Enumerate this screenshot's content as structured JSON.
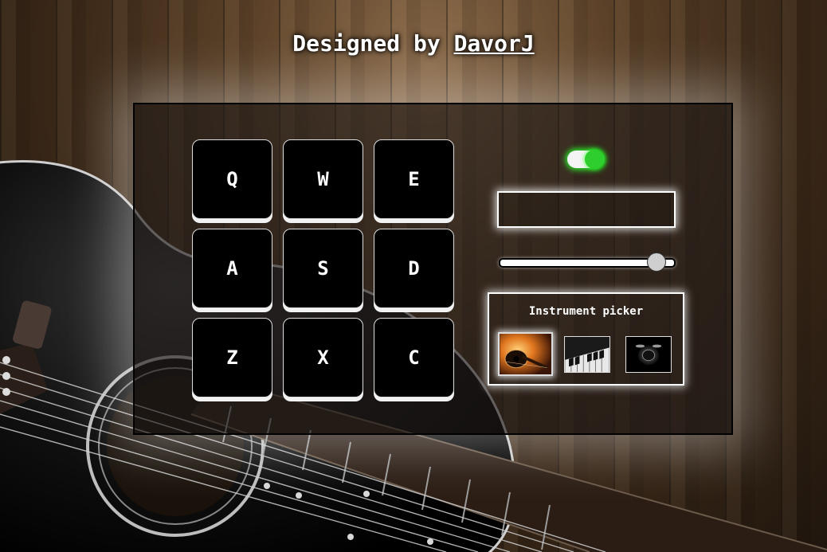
{
  "header": {
    "prefix": "Designed by",
    "author": "DavorJ"
  },
  "pads": [
    {
      "key": "Q"
    },
    {
      "key": "W"
    },
    {
      "key": "E"
    },
    {
      "key": "A"
    },
    {
      "key": "S"
    },
    {
      "key": "D"
    },
    {
      "key": "Z"
    },
    {
      "key": "X"
    },
    {
      "key": "C"
    }
  ],
  "controls": {
    "power": {
      "state": "on",
      "color": "#2fce2f"
    },
    "display": {
      "text": ""
    },
    "volume": {
      "value": 0.93
    }
  },
  "instrument_picker": {
    "title": "Instrument picker",
    "options": [
      {
        "name": "guitar",
        "selected": true
      },
      {
        "name": "piano",
        "selected": false
      },
      {
        "name": "drum",
        "selected": false
      }
    ]
  }
}
